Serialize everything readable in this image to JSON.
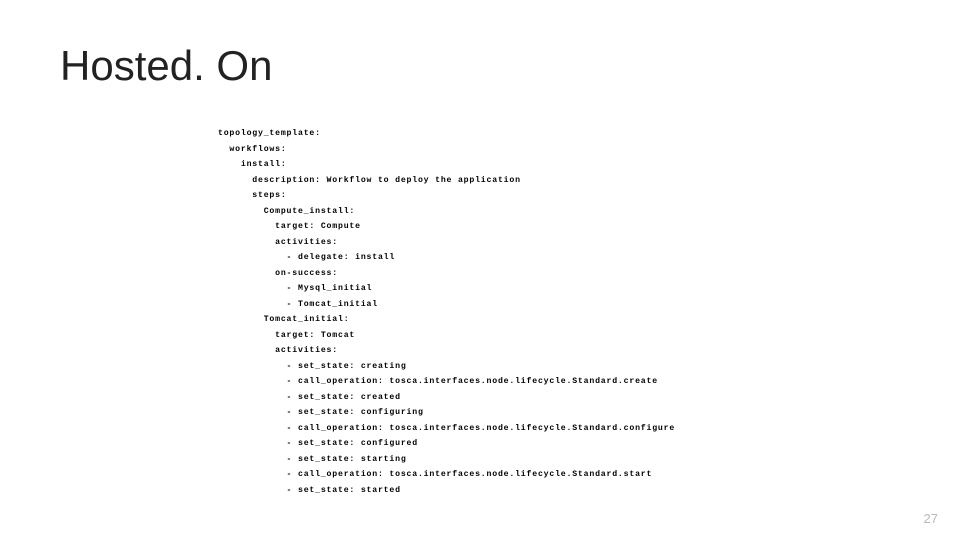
{
  "title": "Hosted. On",
  "page_number": "27",
  "code_lines": [
    "topology_template:",
    "  workflows:",
    "    install:",
    "      description: Workflow to deploy the application",
    "      steps:",
    "        Compute_install:",
    "          target: Compute",
    "          activities:",
    "            - delegate: install",
    "          on-success:",
    "            - Mysql_initial",
    "            - Tomcat_initial",
    "        Tomcat_initial:",
    "          target: Tomcat",
    "          activities:",
    "            - set_state: creating",
    "            - call_operation: tosca.interfaces.node.lifecycle.Standard.create",
    "            - set_state: created",
    "            - set_state: configuring",
    "            - call_operation: tosca.interfaces.node.lifecycle.Standard.configure",
    "            - set_state: configured",
    "            - set_state: starting",
    "            - call_operation: tosca.interfaces.node.lifecycle.Standard.start",
    "            - set_state: started"
  ]
}
